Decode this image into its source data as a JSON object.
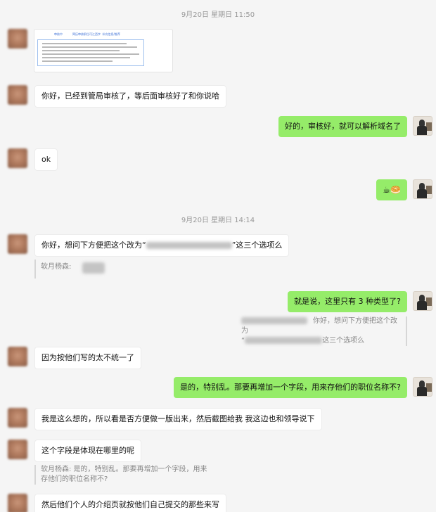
{
  "timestamps": [
    "9月20日 星期日 11:50",
    "9月20日 星期日 14:14"
  ],
  "image_card": {
    "tabs": [
      "审核中",
      "简历审核职位可江西字",
      "补充信息/推荐"
    ]
  },
  "messages": [
    {
      "side": "in",
      "text": "你好，已经到管局审核了，等后面审核好了和你说哈"
    },
    {
      "side": "out",
      "text": "好的，审核好，就可以解析域名了"
    },
    {
      "side": "in",
      "text": "ok"
    },
    {
      "side": "out",
      "text": "☕🥯",
      "icons": [
        "coffee-emoji",
        "bread-emoji"
      ]
    },
    {
      "side": "in",
      "text_before": "你好，想问下方便把这个改为“",
      "text_after": "”这三个选项么"
    },
    {
      "side": "out",
      "text": "就是说，这里只有 3 种类型了?"
    },
    {
      "side": "in",
      "text": "因为按他们写的太不统一了"
    },
    {
      "side": "out",
      "text": "是的，特别乱。那要再增加一个字段，用来存他们的职位名称不?"
    },
    {
      "side": "in",
      "text": "我是这么想的，所以看是否方便做一版出来，然后截图给我 我这边也和领导说下"
    },
    {
      "side": "in",
      "text": "这个字段是体现在哪里的呢"
    },
    {
      "side": "in",
      "text": "然后他们个人的介绍页就按他们自己提交的那些来写"
    }
  ],
  "quotes": [
    {
      "side": "left",
      "sender": "软月杨森:"
    },
    {
      "side": "right",
      "line1": "你好，想问下方便把这个改为",
      "line2_prefix": "“",
      "line2_suffix": "这三个选项么"
    },
    {
      "side": "left",
      "line1": "软月杨森: 是的，特别乱。那要再增加一个字段，用来",
      "line2": "存他们的职位名称不?"
    }
  ]
}
